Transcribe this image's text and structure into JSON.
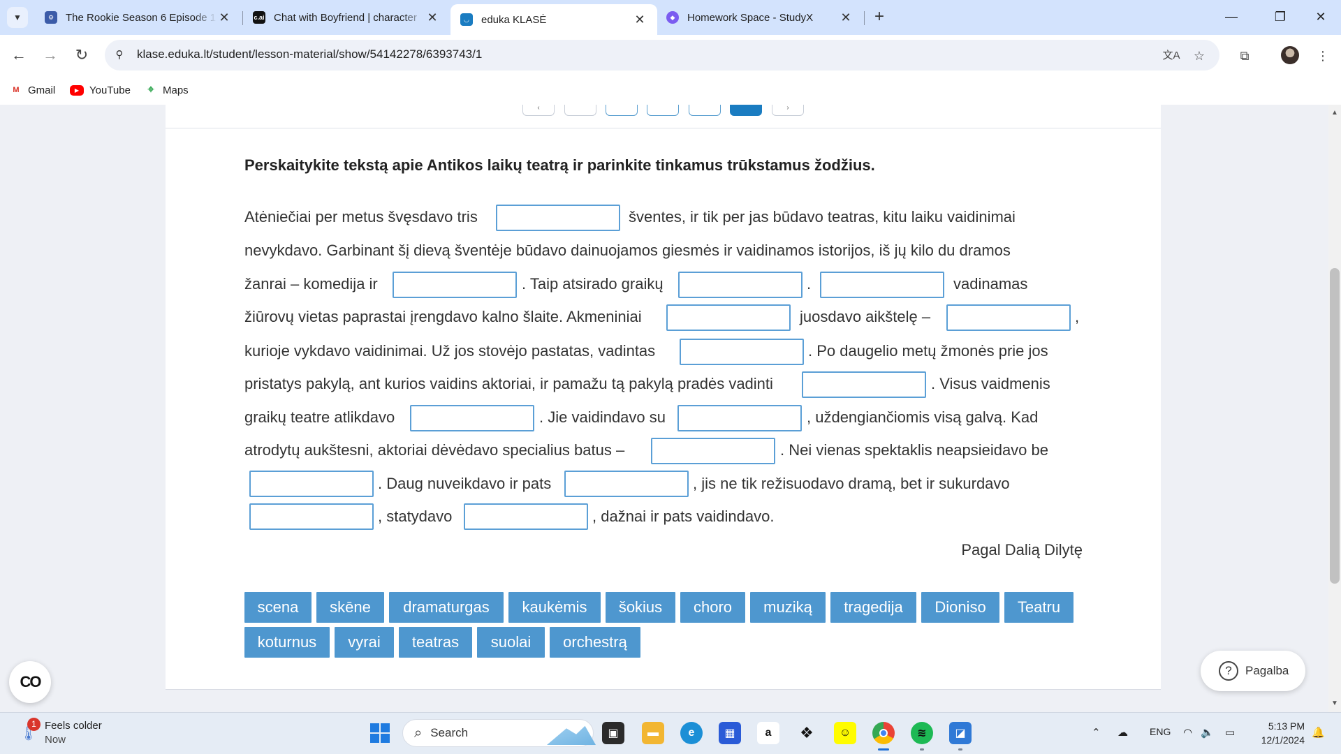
{
  "browser": {
    "tabs": [
      {
        "title": "The Rookie Season 6 Episode 1:",
        "favicon_color": "#3b5ba8",
        "favicon_text": "",
        "active": false
      },
      {
        "title": "Chat with Boyfriend | character",
        "favicon_color": "#111111",
        "favicon_text": "c.ai",
        "active": false
      },
      {
        "title": "eduka KLASĖ",
        "favicon_color": "#1a7cc1",
        "favicon_text": "",
        "active": true
      },
      {
        "title": "Homework Space - StudyX",
        "favicon_color": "#7b5cf0",
        "favicon_text": "",
        "active": false
      }
    ],
    "new_tab_label": "+",
    "window_controls": {
      "minimize": "—",
      "restore": "❐",
      "close": "✕"
    },
    "url": "klase.eduka.lt/student/lesson-material/show/54142278/6393743/1",
    "bookmarks": [
      {
        "label": "Gmail",
        "icon": "gmail-icon"
      },
      {
        "label": "YouTube",
        "icon": "youtube-icon"
      },
      {
        "label": "Maps",
        "icon": "maps-icon"
      }
    ]
  },
  "lesson": {
    "pager": {
      "prev": "‹",
      "next": "›",
      "current_index": 5
    },
    "instruction": "Perskaitykite tekstą apie Antikos laikų teatrą ir parinkite tinkamus trūkstamus žodžius.",
    "segments": [
      "Atėniečiai per metus švęsdavo tris",
      "šventes, ir tik per jas būdavo teatras, kitu laiku vaidinimai",
      "nevykdavo. Garbinant šį dievą šventėje būdavo dainuojamos giesmės ir vaidinamos istorijos, iš jų kilo du dramos",
      "žanrai – komedija ir",
      ". Taip atsirado graikų",
      ".",
      "vadinamas",
      "žiūrovų vietas paprastai įrengdavo kalno šlaite. Akmeniniai",
      "juosdavo aikštelę –",
      ",",
      "kurioje vykdavo vaidinimai. Už jos stovėjo pastatas, vadintas",
      ". Po daugelio metų žmonės prie jos",
      "pristatys pakylą, ant kurios vaidins aktoriai, ir pamažu tą pakylą pradės vadinti",
      ". Visus vaidmenis",
      "graikų teatre atlikdavo",
      ". Jie vaidindavo su",
      ", uždengiančiomis visą galvą. Kad",
      "atrodytų aukštesni, aktoriai dėvėdavo specialius batus –",
      ". Nei vienas spektaklis neapsieidavo be",
      ". Daug nuveikdavo ir pats",
      ", jis ne tik režisuodavo dramą, bet ir sukurdavo",
      ", statydavo",
      ", dažnai ir pats vaidindavo."
    ],
    "blanks": [
      "",
      "",
      "",
      "",
      "",
      "",
      "",
      "",
      "",
      "",
      "",
      "",
      "",
      "",
      "",
      ""
    ],
    "author": "Pagal Dalią Dilytę",
    "word_bank": [
      "scena",
      "skēne",
      "dramaturgas",
      "kaukėmis",
      "šokius",
      "choro",
      "muziką",
      "tragedija",
      "Dioniso",
      "Teatru",
      "koturnus",
      "vyrai",
      "teatras",
      "suolai",
      "orchestrą"
    ],
    "help_label": "Pagalba",
    "cc_label": "CO"
  },
  "taskbar": {
    "weather_title": "Feels colder",
    "weather_sub": "Now",
    "weather_badge": "1",
    "search_placeholder": "Search",
    "lang": "ENG",
    "time": "5:13 PM",
    "date": "12/1/2024"
  }
}
